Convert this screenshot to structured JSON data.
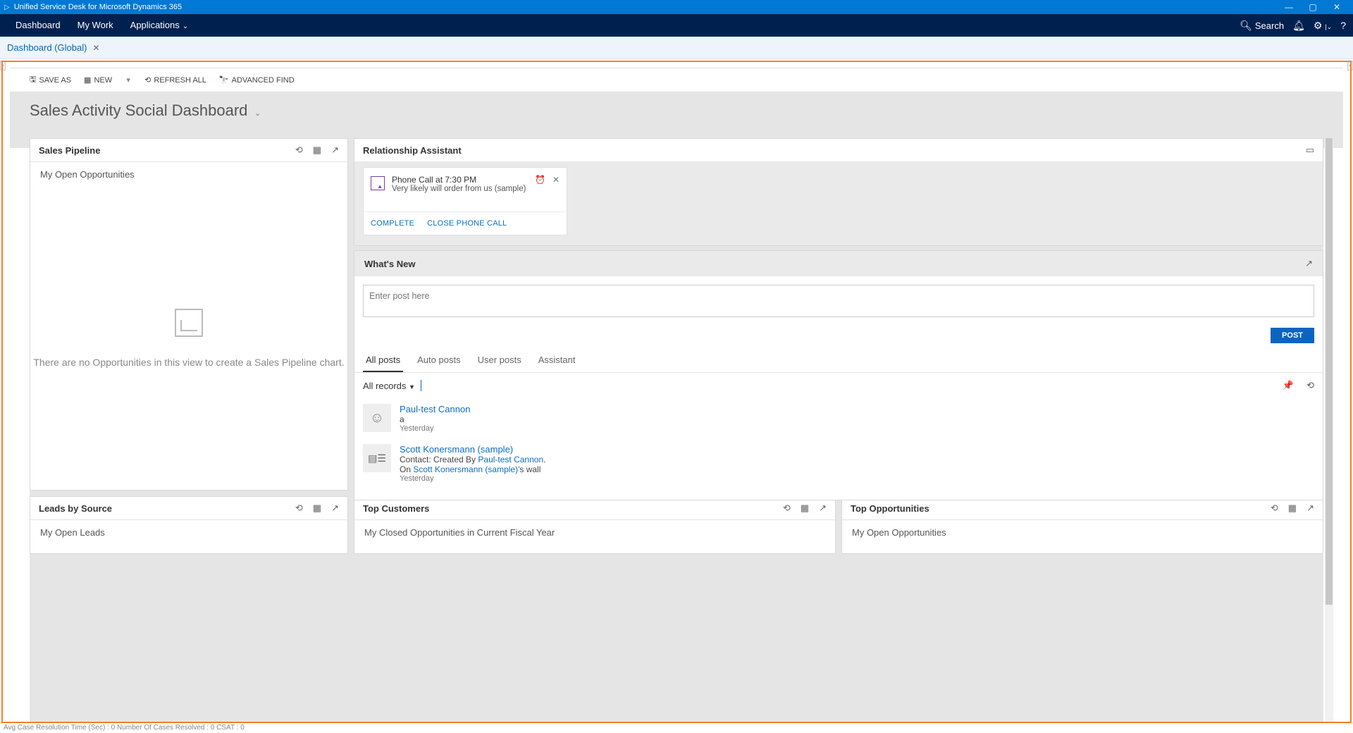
{
  "title_bar": {
    "app_title": "Unified Service Desk for Microsoft Dynamics 365"
  },
  "main_nav": {
    "items": [
      "Dashboard",
      "My Work",
      "Applications"
    ],
    "search_label": "Search"
  },
  "tabs": {
    "active": "Dashboard (Global)"
  },
  "toolbar": {
    "save_as": "SAVE AS",
    "new": "NEW",
    "refresh_all": "REFRESH ALL",
    "advanced_find": "ADVANCED FIND"
  },
  "dashboard": {
    "title": "Sales Activity Social Dashboard"
  },
  "sales_pipeline": {
    "title": "Sales Pipeline",
    "subtitle": "My Open Opportunities",
    "empty_msg": "There are no Opportunities in this view to create a Sales Pipeline chart."
  },
  "relationship_assistant": {
    "title": "Relationship Assistant",
    "card": {
      "line1": "Phone Call at 7:30 PM",
      "line2": "Very likely will order from us (sample)",
      "action_complete": "COMPLETE",
      "action_close": "CLOSE PHONE CALL"
    }
  },
  "whats_new": {
    "title": "What's New",
    "placeholder": "Enter post here",
    "post_btn": "POST",
    "tabs": [
      "All posts",
      "Auto posts",
      "User posts",
      "Assistant"
    ],
    "filter_label": "All records",
    "posts": [
      {
        "name": "Paul-test Cannon",
        "content": "a",
        "timestamp": "Yesterday"
      },
      {
        "name": "Scott Konersmann (sample)",
        "prefix": "Contact: Created By ",
        "link1": "Paul-test Cannon",
        "line2a": "On ",
        "line2b": "Scott Konersmann (sample)",
        "line2c": "'s wall",
        "timestamp": "Yesterday"
      }
    ]
  },
  "leads_by_source": {
    "title": "Leads by Source",
    "subtitle": "My Open Leads"
  },
  "top_customers": {
    "title": "Top Customers",
    "subtitle": "My Closed Opportunities in Current Fiscal Year"
  },
  "top_opportunities": {
    "title": "Top Opportunities",
    "subtitle": "My Open Opportunities"
  },
  "status": {
    "text": "Avg Case Resolution Time (Sec) :   0   Number Of Cases Resolved :   0   CSAT :   0"
  }
}
